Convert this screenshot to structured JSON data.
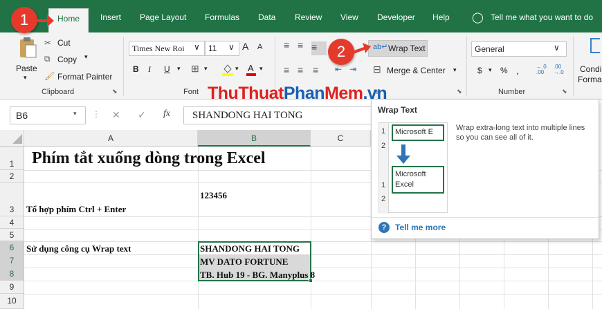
{
  "tabs": {
    "home": "Home",
    "insert": "Insert",
    "page_layout": "Page Layout",
    "formulas": "Formulas",
    "data": "Data",
    "review": "Review",
    "view": "View",
    "developer": "Developer",
    "help": "Help",
    "tell_me": "Tell me what you want to do"
  },
  "badges": {
    "one": "1",
    "two": "2"
  },
  "clipboard": {
    "paste": "Paste",
    "cut": "Cut",
    "copy": "Copy",
    "format_painter": "Format Painter",
    "group_label": "Clipboard"
  },
  "font": {
    "name": "Times New Roi",
    "size": "11",
    "bold": "B",
    "italic": "I",
    "underline": "U",
    "group_label": "Font",
    "grow": "A",
    "shrink": "A",
    "font_color_letter": "A"
  },
  "alignment": {
    "wrap_text": "Wrap Text",
    "merge_center": "Merge & Center",
    "group_label": "nt"
  },
  "number": {
    "format": "General",
    "currency": "$",
    "percent": "%",
    "comma": ",",
    "group_label": "Number",
    "inc_dec": "←.0 .00",
    "dec_dec": ".00 →.0"
  },
  "styles": {
    "conditional": "Condi",
    "format": "Forma"
  },
  "watermark": {
    "part1": "Thu",
    "part2": "Thuat",
    "part3": "Phan",
    "part4": "Mem",
    "part5": ".vn"
  },
  "formula_bar": {
    "name_box": "B6",
    "fx": "fx",
    "cancel": "✕",
    "enter": "✓",
    "content": "SHANDONG HAI TONG"
  },
  "columns": [
    "A",
    "B",
    "C"
  ],
  "rows": [
    "1",
    "2",
    "3",
    "4",
    "5",
    "6",
    "7",
    "8",
    "9",
    "10"
  ],
  "cells": {
    "a1": "Phím tắt xuống dòng trong Excel",
    "b3": "123456",
    "a3": "Tổ hợp phím Ctrl + Enter",
    "a6": "Sử dụng công cụ Wrap text",
    "b6": "SHANDONG HAI TONG",
    "b7": "MV DATO FORTUNE",
    "b8": "TB. Hub 19 - BG. Manyplus 8"
  },
  "tooltip": {
    "title": "Wrap Text",
    "description": "Wrap extra-long text into multiple lines so you can see all of it.",
    "before_row1": "1",
    "before_text": "Microsoft E",
    "before_row2": "2",
    "after_row1": "1",
    "after_line1": "Microsoft",
    "after_line2": "Excel",
    "after_row2": "2",
    "tell_me_more": "Tell me more"
  },
  "colors": {
    "excel_green": "#217346",
    "badge_red": "#e53a2b",
    "watermark_red": "#e02020",
    "watermark_blue": "#1a5fb4"
  }
}
